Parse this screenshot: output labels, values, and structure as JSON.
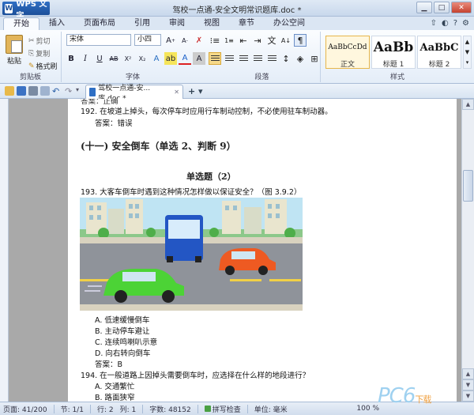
{
  "window": {
    "app_button": "WPS 文字",
    "title": "驾校一点通-安全文明常识题库.doc *"
  },
  "menu": {
    "tabs": [
      "开始",
      "插入",
      "页面布局",
      "引用",
      "审阅",
      "视图",
      "章节",
      "办公空间"
    ]
  },
  "ribbon": {
    "clipboard": {
      "label": "剪贴板",
      "paste": "粘贴",
      "cut": "剪切",
      "copy": "复制",
      "format_painter": "格式刷"
    },
    "font": {
      "label": "字体",
      "font_name": "宋体",
      "font_size": "小四"
    },
    "paragraph": {
      "label": "段落"
    },
    "styles": {
      "label": "样式",
      "items": [
        {
          "sample": "AaBbCcDd",
          "name": "正文"
        },
        {
          "sample": "AaBb",
          "name": "标题 1"
        },
        {
          "sample": "AaBbC",
          "name": "标题 2"
        }
      ]
    }
  },
  "doc_tab": {
    "label": "驾校一点通-安...库.doc *"
  },
  "document": {
    "cut_line": "答案：正确",
    "q192": "192. 在坡道上掉头，每次停车时应用行车制动控制，不必使用驻车制动器。",
    "a192": "答案：错误",
    "section_heading": "(十一)  安全倒车（单选 2、判断 9）",
    "subheading": "单选题（2）",
    "q193": "193. 大客车倒车时遇到这种情况怎样做以保证安全？（图 3.9.2）",
    "options": [
      "A.  低速缓慢倒车",
      "B.  主动停车避让",
      "C.  连续鸣喇叭示意",
      "D.  向右转向倒车"
    ],
    "a193": "答案：B",
    "q194": "194. 在一般道路上因掉头需要倒车时，应选择在什么样的地段进行？",
    "q194_a": "A.  交通繁忙",
    "q194_b": "B.  路面狭窄"
  },
  "status": {
    "page": "页面: 41/200",
    "section": "节: 1/1",
    "row": "行: 2",
    "col": "列: 1",
    "words": "字数: 48152",
    "spell": "拼写检查",
    "unit": "单位: 毫米",
    "zoom": "100 %"
  },
  "watermark": {
    "text": "PC6",
    "small": "下载"
  }
}
